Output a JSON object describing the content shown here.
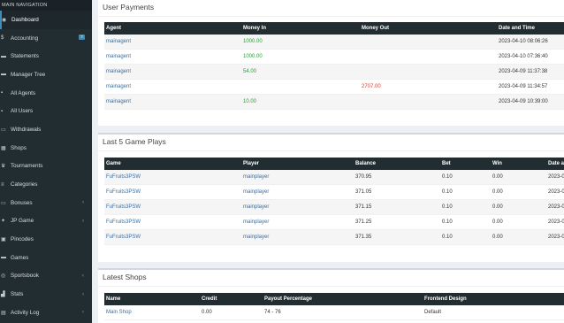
{
  "sidebar": {
    "header": "MAIN NAVIGATION",
    "items": [
      {
        "label": "Dashboard",
        "icon": "dashboard-icon",
        "glyph": "◉",
        "active": true
      },
      {
        "label": "Accounting",
        "icon": "dollar-icon",
        "glyph": "$",
        "badge": "?"
      },
      {
        "label": "Statements",
        "icon": "chart-icon",
        "glyph": "▬"
      },
      {
        "label": "Manager Tree",
        "icon": "tree-icon",
        "glyph": "▬"
      },
      {
        "label": "All Agents",
        "icon": "agents-icon",
        "glyph": "▪"
      },
      {
        "label": "All Users",
        "icon": "users-icon",
        "glyph": "▪"
      },
      {
        "label": "Withdrawals",
        "icon": "withdraw-icon",
        "glyph": "▭"
      },
      {
        "label": "Shops",
        "icon": "shop-icon",
        "glyph": "▦"
      },
      {
        "label": "Tournaments",
        "icon": "trophy-icon",
        "glyph": "♛"
      },
      {
        "label": "Categories",
        "icon": "categories-icon",
        "glyph": "≡"
      },
      {
        "label": "Bonuses",
        "icon": "bonus-icon",
        "glyph": "▭",
        "chevron": true
      },
      {
        "label": "JP Game",
        "icon": "jp-game-icon",
        "glyph": "✦",
        "chevron": true
      },
      {
        "label": "Pincodes",
        "icon": "pincode-icon",
        "glyph": "▣"
      },
      {
        "label": "Games",
        "icon": "games-icon",
        "glyph": "▬"
      },
      {
        "label": "Sportsbook",
        "icon": "sportsbook-icon",
        "glyph": "◎",
        "chevron": true
      },
      {
        "label": "Stats",
        "icon": "stats-icon",
        "glyph": "▟",
        "chevron": true
      },
      {
        "label": "Activity Log",
        "icon": "activity-log-icon",
        "glyph": "▤",
        "chevron": true
      }
    ]
  },
  "payments": {
    "title": "User Payments",
    "headers": [
      "Agent",
      "Money In",
      "Money Out",
      "Date and Time"
    ],
    "rows": [
      {
        "agent": "mainagent",
        "in": "1000.00",
        "out": "",
        "date": "2023-04-10 08:06:26"
      },
      {
        "agent": "mainagent",
        "in": "1000.00",
        "out": "",
        "date": "2023-04-10 07:36:40"
      },
      {
        "agent": "mainagent",
        "in": "54.00",
        "out": "",
        "date": "2023-04-09 11:37:38"
      },
      {
        "agent": "mainagent",
        "in": "",
        "out": "2707.00",
        "date": "2023-04-09 11:34:57"
      },
      {
        "agent": "mainagent",
        "in": "10.00",
        "out": "",
        "date": "2023-04-09 10:39:00"
      }
    ]
  },
  "plays": {
    "title": "Last 5 Game Plays",
    "headers": [
      "Game",
      "Player",
      "Balance",
      "Bet",
      "Win",
      "Date a"
    ],
    "rows": [
      {
        "game": "FuFruits3PSW",
        "player": "mainplayer",
        "balance": "370.95",
        "bet": "0.10",
        "win": "0.00",
        "date": "2023-0"
      },
      {
        "game": "FuFruits3PSW",
        "player": "mainplayer",
        "balance": "371.05",
        "bet": "0.10",
        "win": "0.00",
        "date": "2023-0"
      },
      {
        "game": "FuFruits3PSW",
        "player": "mainplayer",
        "balance": "371.15",
        "bet": "0.10",
        "win": "0.00",
        "date": "2023-0"
      },
      {
        "game": "FuFruits3PSW",
        "player": "mainplayer",
        "balance": "371.25",
        "bet": "0.10",
        "win": "0.00",
        "date": "2023-0"
      },
      {
        "game": "FuFruits3PSW",
        "player": "mainplayer",
        "balance": "371.35",
        "bet": "0.10",
        "win": "0.00",
        "date": "2023-0"
      }
    ]
  },
  "shops": {
    "title": "Latest Shops",
    "headers": [
      "Name",
      "Credit",
      "Payout Percentage",
      "Frontend Design"
    ],
    "rows": [
      {
        "name": "Main Shop",
        "credit": "0.00",
        "payout": "74 - 76",
        "design": "Default"
      }
    ]
  }
}
